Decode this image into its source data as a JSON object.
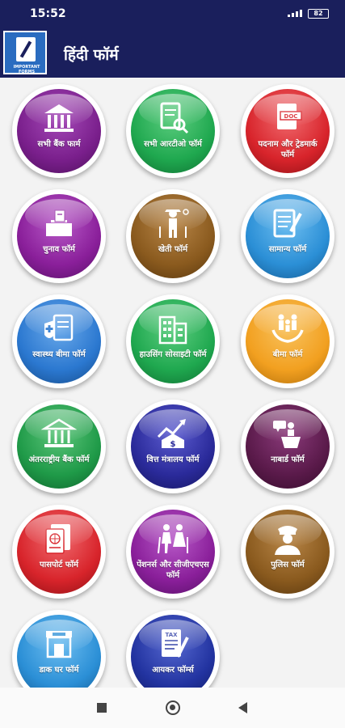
{
  "status": {
    "time": "15:52",
    "battery": "82"
  },
  "appbar": {
    "logo_caption": "IMPORTANT FORMS",
    "title": "हिंदी फॉर्म"
  },
  "colors": {
    "bar": "#1a1f5c",
    "purple": "#7a1f8c",
    "green": "#1fa84f",
    "red": "#d8242b",
    "brown": "#8a5a1e",
    "blue": "#2b8fd6",
    "orange": "#f2a020",
    "dark_purple": "#5a1a4a",
    "royal": "#2233a0"
  },
  "tiles": [
    {
      "label": "सभी बैंक फार्म",
      "icon": "bank-icon",
      "color": "#7a1f8c"
    },
    {
      "label": "सभी आरटीओ फॉर्म",
      "icon": "document-search-icon",
      "color": "#1fa84f"
    },
    {
      "label": "पदनाम और ट्रेडमार्क फॉर्म",
      "icon": "doc-file-icon",
      "color": "#d8242b"
    },
    {
      "label": "चुनाव फॉर्म",
      "icon": "ballot-box-icon",
      "color": "#8a1f9a"
    },
    {
      "label": "खेती फॉर्म",
      "icon": "farmer-icon",
      "color": "#8a5a1e"
    },
    {
      "label": "सामान्य फॉर्म",
      "icon": "form-pencil-icon",
      "color": "#2b8fd6"
    },
    {
      "label": "स्वास्थ्य बीमा फॉर्म",
      "icon": "health-insurance-icon",
      "color": "#2b78d0"
    },
    {
      "label": "हाउसिंग सोसाइटी फॉर्म",
      "icon": "buildings-icon",
      "color": "#1fa84f"
    },
    {
      "label": "बीमा फॉर्म",
      "icon": "family-hands-icon",
      "color": "#f2a020"
    },
    {
      "label": "अंतरराष्ट्रीय बैंक फॉर्म",
      "icon": "institution-icon",
      "color": "#1f9a48"
    },
    {
      "label": "वित्त मंत्रालय फॉर्म",
      "icon": "finance-growth-icon",
      "color": "#2a2a9a"
    },
    {
      "label": "नाबार्ड फॉर्म",
      "icon": "speaker-podium-icon",
      "color": "#5a1a4a"
    },
    {
      "label": "पासपोर्ट फॉर्म",
      "icon": "passport-icon",
      "color": "#d8242b"
    },
    {
      "label": "पेंशनर्स और सीजीएचएस फॉर्म",
      "icon": "elderly-couple-icon",
      "color": "#8a1f9a"
    },
    {
      "label": "पुलिस फॉर्म",
      "icon": "police-icon",
      "color": "#8a5a1e"
    },
    {
      "label": "डाक घर फॉर्म",
      "icon": "post-office-icon",
      "color": "#2b8fd6"
    },
    {
      "label": "आयकर फॉर्म्स",
      "icon": "tax-form-icon",
      "color": "#2233a0"
    }
  ]
}
